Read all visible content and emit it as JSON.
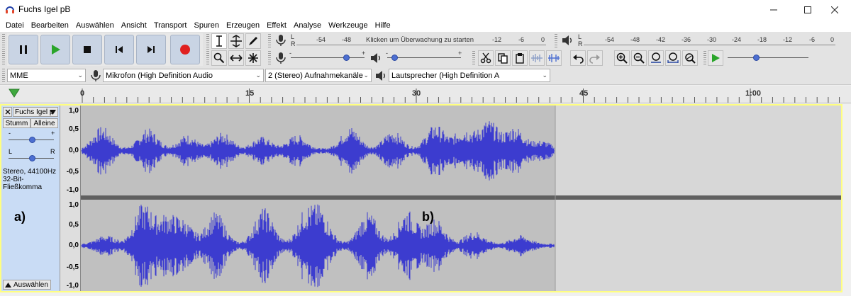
{
  "window": {
    "title": "Fuchs Igel pB"
  },
  "menu": [
    "Datei",
    "Bearbeiten",
    "Auswählen",
    "Ansicht",
    "Transport",
    "Spuren",
    "Erzeugen",
    "Effekt",
    "Analyse",
    "Werkzeuge",
    "Hilfe"
  ],
  "record_meter": {
    "channels": [
      "L",
      "R"
    ],
    "scale": [
      "-54",
      "-48",
      "-12",
      "-6",
      "0"
    ],
    "prompt": "Klicken um Überwachung zu starten"
  },
  "playback_meter": {
    "channels": [
      "L",
      "R"
    ],
    "scale": [
      "-54",
      "-48",
      "-42",
      "-36",
      "-30",
      "-24",
      "-18",
      "-12",
      "-6",
      "0"
    ]
  },
  "slider_marks": {
    "minus": "-",
    "plus": "+"
  },
  "devices": {
    "host": "MME",
    "recording_device": "Mikrofon (High Definition Audio",
    "channels": "2 (Stereo) Aufnahmekanäle",
    "playback_device": "Lautsprecher (High Definition A"
  },
  "ruler": {
    "labels": [
      "0",
      "15",
      "30",
      "45",
      "1:00"
    ]
  },
  "track": {
    "name": "Fuchs Igel p",
    "mute": "Stumm",
    "solo": "Alleine",
    "pan_left": "L",
    "pan_right": "R",
    "gain_minus": "-",
    "gain_plus": "+",
    "info_rate": "Stereo, 44100Hz",
    "info_format": "32-Bit-Fließkomma",
    "select": "Auswählen",
    "scale_labels": [
      "1,0",
      "0,5",
      "0,0",
      "-0,5",
      "-1,0"
    ]
  },
  "annotations": {
    "a": "a)",
    "b": "b)"
  },
  "colors": {
    "waveform": "#3c3ccf",
    "selected_bg": "#c0c0c0",
    "unselected_bg": "#d7d7d7",
    "track_border": "#ffff80",
    "track_panel": "#c9dcf5"
  }
}
